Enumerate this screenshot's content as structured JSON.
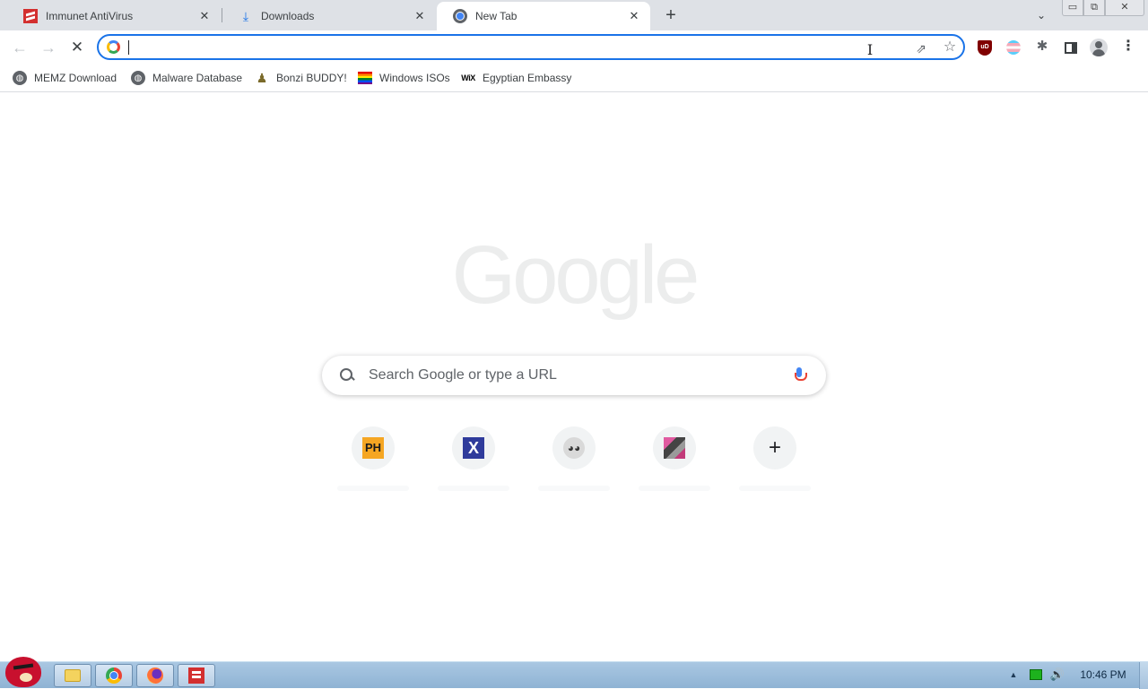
{
  "browser": {
    "tabs": [
      {
        "title": "Immunet AntiVirus",
        "icon": "immunet-icon",
        "active": false
      },
      {
        "title": "Downloads",
        "icon": "download-icon",
        "active": false
      },
      {
        "title": "New Tab",
        "icon": "chrome-icon",
        "active": true
      }
    ],
    "tab_close_glyph": "✕",
    "new_tab_glyph": "+",
    "tab_search_glyph": "⌄",
    "window_controls": {
      "minimize": "▭",
      "maximize": "⧉",
      "close": "✕"
    },
    "nav": {
      "back": "←",
      "forward": "→",
      "stop": "✕"
    },
    "omnibox": {
      "value": "",
      "placeholder": ""
    },
    "toolbar_icons": [
      "share-icon",
      "star-icon",
      "ublock-icon",
      "flag-extension-icon",
      "extensions-icon",
      "side-panel-icon",
      "profile-icon",
      "menu-icon"
    ],
    "ublock_text": "uD",
    "menu_glyph": "⋮",
    "extensions_glyph": "✱",
    "share_glyph": "⇗",
    "star_glyph": "☆",
    "text_cursor_glyph": "I"
  },
  "bookmarks": [
    {
      "label": "MEMZ Download",
      "icon": "globe-icon"
    },
    {
      "label": "Malware Database",
      "icon": "globe-icon"
    },
    {
      "label": "Bonzi BUDDY!",
      "icon": "bonzi-icon"
    },
    {
      "label": "Windows ISOs",
      "icon": "rainbow-flag-icon"
    },
    {
      "label": "Egyptian Embassy",
      "icon": "wix-icon"
    }
  ],
  "wix_text": "WiX",
  "globe_glyph": "◍",
  "bonzi_glyph": "♟",
  "ntp": {
    "logo_text": "Google",
    "search_placeholder": "Search Google or type a URL",
    "shortcuts": [
      {
        "icon": "ph-icon",
        "badge": "PH"
      },
      {
        "icon": "xv-icon",
        "badge": "X"
      },
      {
        "icon": "raccoon-icon",
        "badge": "◕◕"
      },
      {
        "icon": "picture-icon",
        "badge": ""
      },
      {
        "icon": "add-shortcut-icon",
        "badge": "+"
      }
    ]
  },
  "taskbar": {
    "apps": [
      "file-explorer",
      "google-chrome",
      "firefox",
      "immunet"
    ],
    "tray_arrow": "▲",
    "volume_glyph": "🔊",
    "time": "10:46 PM"
  }
}
